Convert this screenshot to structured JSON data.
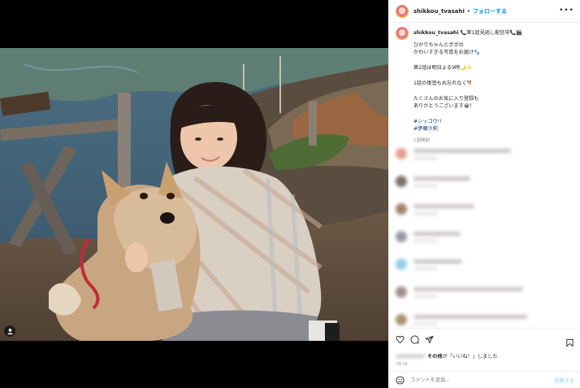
{
  "post": {
    "username": "shikkou_tvasahi",
    "follow_label": "フォローする",
    "more_label": "•••",
    "dot": "•",
    "caption": {
      "first_line": "📞第1話見逃し配信中📞🎬",
      "lines": [
        "ひかりちゃんとポポの\nかわいすぎる写真をお届け🐾",
        "第2話は明日よる9時🌙✨",
        "1話の復習もお忘れなく🐕",
        "たくさんのお気に入り登録も\nありがとうございます😭！"
      ],
      "hashtags": [
        "#シッコウ!!",
        "#伊藤沙莉"
      ],
      "time_ago": "1週間前"
    },
    "comments": [
      {
        "avatar_color": "#e8a08d",
        "w1": 120
      },
      {
        "avatar_color": "#7d6f6a",
        "w1": 70
      },
      {
        "avatar_color": "#a3826b",
        "w1": 75
      },
      {
        "avatar_color": "#9a9aa8",
        "w1": 58
      },
      {
        "avatar_color": "#98cde8",
        "w1": 60
      },
      {
        "avatar_color": "#a0908a",
        "w1": 135
      },
      {
        "avatar_color": "#a59370",
        "w1": 140
      }
    ],
    "likes": {
      "suffix_bold": "その他",
      "suffix": "が「いいね！」しました"
    },
    "date": "7月 18",
    "comment_placeholder": "コメントを追加...",
    "post_label": "投稿する"
  },
  "icons": {
    "heart": "heart-icon",
    "comment": "comment-icon",
    "share": "share-icon",
    "save": "bookmark-icon",
    "emoji": "emoji-icon",
    "tag": "user-tag-icon"
  }
}
